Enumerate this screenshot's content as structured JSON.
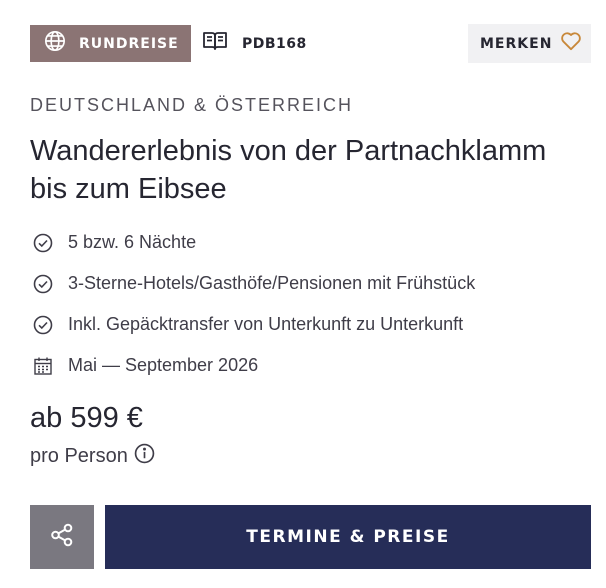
{
  "header": {
    "type_badge": {
      "label": "RUNDREISE",
      "icon": "globe-icon",
      "color": "#8b7474"
    },
    "code": {
      "label": "PDB168",
      "icon": "book-icon"
    },
    "bookmark": {
      "label": "MERKEN",
      "icon": "heart-icon",
      "icon_color": "#c8883a"
    }
  },
  "trip": {
    "region": "DEUTSCHLAND & ÖSTERREICH",
    "title": "Wandererlebnis von der Partnachklamm bis zum Eibsee",
    "features": [
      {
        "icon": "check-circle-icon",
        "text": "5 bzw. 6 Nächte"
      },
      {
        "icon": "check-circle-icon",
        "text": "3-Sterne-Hotels/Gasthöfe/Pensionen mit Frühstück"
      },
      {
        "icon": "check-circle-icon",
        "text": "Inkl. Gepäcktransfer von Unterkunft zu Unterkunft"
      },
      {
        "icon": "calendar-icon",
        "text": "Mai — September 2026"
      }
    ]
  },
  "pricing": {
    "price": "ab 599 €",
    "unit": "pro Person",
    "info_icon": "info-icon"
  },
  "actions": {
    "share_icon": "share-icon",
    "share_color": "#7a7880",
    "cta_label": "TERMINE & PREISE",
    "cta_color": "#262d58"
  }
}
